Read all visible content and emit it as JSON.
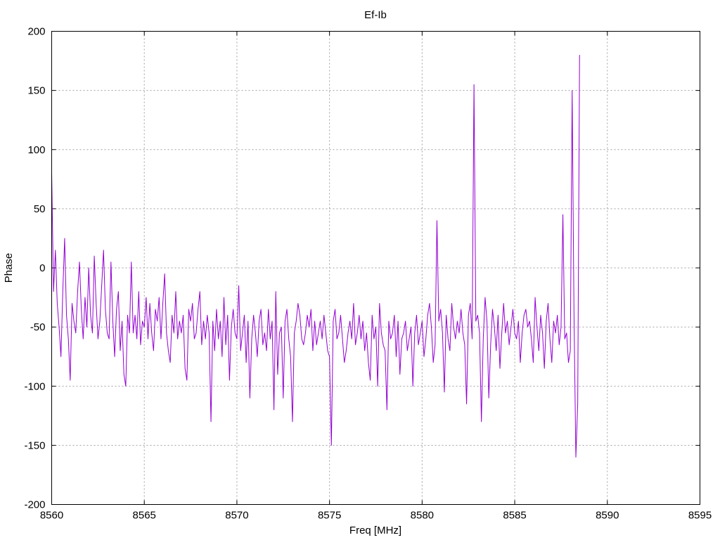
{
  "chart_data": {
    "type": "line",
    "title": "Ef-Ib",
    "xlabel": "Freq [MHz]",
    "ylabel": "Phase",
    "xlim": [
      8560,
      8595
    ],
    "ylim": [
      -200,
      200
    ],
    "xticks": [
      8560,
      8565,
      8570,
      8575,
      8580,
      8585,
      8590,
      8595
    ],
    "yticks": [
      -200,
      -150,
      -100,
      -50,
      0,
      50,
      100,
      150,
      200
    ],
    "grid": true,
    "legend": "none",
    "series_color": "#9400d3",
    "series": [
      {
        "x_start": 8560.0,
        "x_step": 0.1,
        "values": [
          80,
          -20,
          15,
          -30,
          -50,
          -75,
          -20,
          25,
          -40,
          -60,
          -95,
          -30,
          -45,
          -55,
          -20,
          5,
          -35,
          -60,
          -25,
          -50,
          0,
          -40,
          -55,
          10,
          -30,
          -60,
          -45,
          -15,
          15,
          -35,
          -55,
          -60,
          5,
          -45,
          -75,
          -35,
          -20,
          -70,
          -45,
          -90,
          -100,
          -40,
          -55,
          5,
          -55,
          -40,
          -60,
          -20,
          -65,
          -45,
          -50,
          -25,
          -60,
          -30,
          -55,
          -70,
          -35,
          -45,
          -25,
          -60,
          -30,
          -5,
          -55,
          -70,
          -80,
          -40,
          -55,
          -20,
          -60,
          -45,
          -55,
          -40,
          -85,
          -95,
          -35,
          -45,
          -30,
          -60,
          -55,
          -35,
          -20,
          -65,
          -45,
          -60,
          -40,
          -55,
          -130,
          -45,
          -70,
          -35,
          -60,
          -45,
          -75,
          -25,
          -65,
          -40,
          -95,
          -50,
          -35,
          -55,
          -60,
          -15,
          -70,
          -55,
          -40,
          -80,
          -45,
          -110,
          -60,
          -40,
          -55,
          -75,
          -45,
          -35,
          -65,
          -55,
          -70,
          -35,
          -60,
          -45,
          -120,
          -20,
          -90,
          -55,
          -50,
          -110,
          -45,
          -35,
          -60,
          -75,
          -130,
          -55,
          -45,
          -30,
          -40,
          -60,
          -65,
          -55,
          -40,
          -50,
          -35,
          -70,
          -45,
          -65,
          -55,
          -45,
          -60,
          -40,
          -55,
          -70,
          -75,
          -150,
          -45,
          -35,
          -60,
          -55,
          -40,
          -60,
          -80,
          -70,
          -55,
          -45,
          -60,
          -30,
          -65,
          -55,
          -40,
          -60,
          -45,
          -70,
          -55,
          -80,
          -95,
          -40,
          -60,
          -50,
          -100,
          -30,
          -55,
          -65,
          -70,
          -120,
          -45,
          -60,
          -55,
          -40,
          -75,
          -45,
          -90,
          -60,
          -55,
          -45,
          -70,
          -60,
          -50,
          -100,
          -55,
          -40,
          -65,
          -55,
          -45,
          -75,
          -60,
          -40,
          -30,
          -50,
          -80,
          -65,
          40,
          -45,
          -35,
          -55,
          -105,
          -40,
          -60,
          -70,
          -30,
          -50,
          -60,
          -45,
          -55,
          -35,
          -55,
          -65,
          -115,
          -40,
          -30,
          -60,
          155,
          -45,
          -40,
          -55,
          -130,
          -60,
          -25,
          -45,
          -110,
          -65,
          -35,
          -50,
          -70,
          -40,
          -85,
          -55,
          -30,
          -55,
          -45,
          -65,
          -50,
          -35,
          -55,
          -60,
          -45,
          -80,
          -55,
          -40,
          -35,
          -50,
          -45,
          -60,
          -80,
          -25,
          -50,
          -70,
          -40,
          -55,
          -85,
          -45,
          -30,
          -60,
          -80,
          -45,
          -55,
          -40,
          -65,
          -50,
          45,
          -60,
          -55,
          -80,
          -70,
          150,
          -40,
          -160,
          -115,
          180
        ]
      }
    ]
  }
}
